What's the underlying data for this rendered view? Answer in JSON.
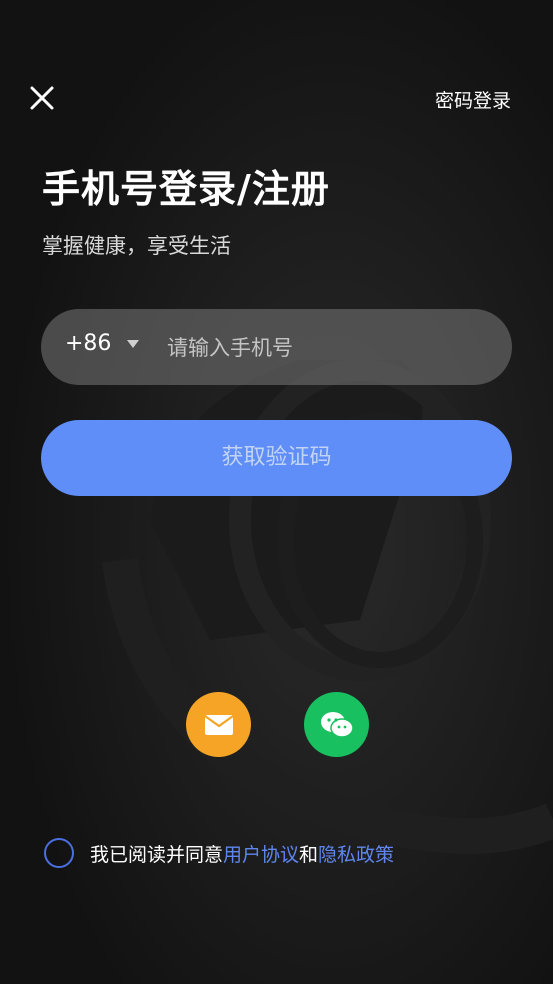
{
  "header": {
    "close_icon": "close-icon",
    "password_login": "密码登录"
  },
  "title": "手机号登录/注册",
  "subtitle": "掌握健康，享受生活",
  "phone": {
    "country_code": "+86",
    "placeholder": "请输入手机号",
    "value": ""
  },
  "get_code_label": "获取验证码",
  "social": {
    "mail_icon": "mail-icon",
    "wechat_icon": "wechat-icon",
    "mail_color": "#f5a425",
    "wechat_color": "#18c060"
  },
  "agreement": {
    "prefix": "我已阅读并同意",
    "user_agreement": "用户协议",
    "and": "和",
    "privacy_policy": "隐私政策"
  },
  "colors": {
    "accent": "#5f8ef8",
    "link": "#5f86f0",
    "background": "#141414"
  }
}
